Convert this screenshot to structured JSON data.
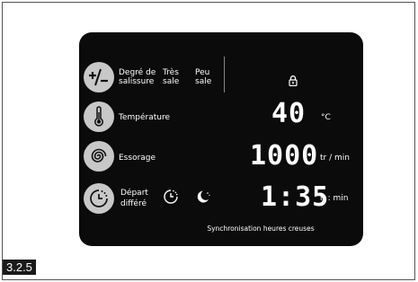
{
  "panel": {
    "soil": {
      "icon": "plus-minus-icon",
      "label_line1": "Degré de",
      "label_line2": "salissure",
      "option1_line1": "Très",
      "option1_line2": "sale",
      "option2_line1": "Peu",
      "option2_line2": "sale"
    },
    "temperature": {
      "icon": "thermometer-icon",
      "label": "Température"
    },
    "spin": {
      "icon": "spiral-icon",
      "label": "Essorage"
    },
    "delay": {
      "icon": "clock-icon",
      "label_line1": "Départ",
      "label_line2": "différé",
      "timer_icon": "timer-icon",
      "night_icon": "moon-icon"
    },
    "lock_icon": "padlock-icon",
    "display": {
      "temperature_value": "40",
      "temperature_unit": "°C",
      "spin_value": "1000",
      "spin_unit": "tr / min",
      "time_value": "1:35",
      "time_unit": "h : min"
    },
    "sync_text": "Synchronisation heures creuses"
  },
  "figure_tag": "3.2.5",
  "colors": {
    "panel": "#0b0b0b",
    "button": "#c8c8c8",
    "text": "#ffffff"
  }
}
